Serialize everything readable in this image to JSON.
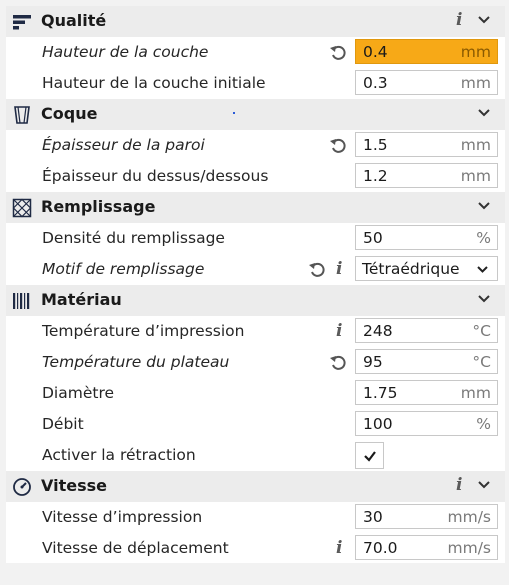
{
  "sections": {
    "quality": {
      "title": "Qualité",
      "rows": [
        {
          "label": "Hauteur de la couche",
          "value": "0.4",
          "unit": "mm"
        },
        {
          "label": "Hauteur de la couche initiale",
          "value": "0.3",
          "unit": "mm"
        }
      ]
    },
    "shell": {
      "title": "Coque",
      "rows": [
        {
          "label": "Épaisseur de la paroi",
          "value": "1.5",
          "unit": "mm"
        },
        {
          "label": "Épaisseur du dessus/dessous",
          "value": "1.2",
          "unit": "mm"
        }
      ]
    },
    "infill": {
      "title": "Remplissage",
      "rows": [
        {
          "label": "Densité du remplissage",
          "value": "50",
          "unit": "%"
        },
        {
          "label": "Motif de remplissage",
          "value": "Tétraédrique"
        }
      ]
    },
    "material": {
      "title": "Matériau",
      "rows": [
        {
          "label": "Température d’impression",
          "value": "248",
          "unit": "°C"
        },
        {
          "label": "Température du plateau",
          "value": "95",
          "unit": "°C"
        },
        {
          "label": "Diamètre",
          "value": "1.75",
          "unit": "mm"
        },
        {
          "label": "Débit",
          "value": "100",
          "unit": "%"
        },
        {
          "label": "Activer la rétraction",
          "checked": true
        }
      ]
    },
    "speed": {
      "title": "Vitesse",
      "rows": [
        {
          "label": "Vitesse d’impression",
          "value": "30",
          "unit": "mm/s"
        },
        {
          "label": "Vitesse de déplacement",
          "value": "70.0",
          "unit": "mm/s"
        }
      ]
    }
  },
  "icons": {
    "info": "i",
    "section_quality": "quality-bars-icon",
    "section_shell": "shell-icon",
    "section_infill": "infill-grid-icon",
    "section_material": "material-spool-icon",
    "section_speed": "speedometer-icon",
    "reset": "reset-arrow-icon",
    "check": "checkmark-icon"
  },
  "colors": {
    "highlight": "#f7a917",
    "section_bg": "#ececec",
    "accent_dot": "#2b5bd7"
  }
}
